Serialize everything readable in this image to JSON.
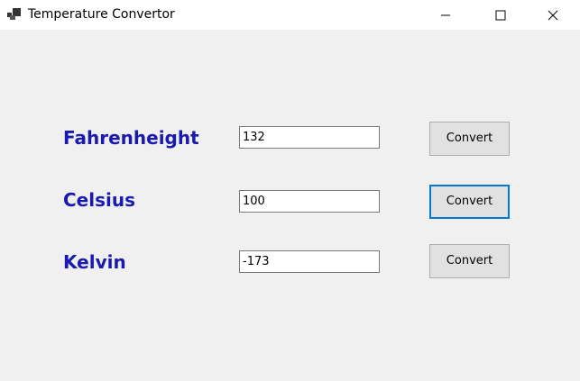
{
  "window": {
    "title": "Temperature Convertor"
  },
  "rows": [
    {
      "label": "Fahrenheight",
      "value": "132",
      "button": "Convert"
    },
    {
      "label": "Celsius",
      "value": "100",
      "button": "Convert"
    },
    {
      "label": "Kelvin",
      "value": "-173",
      "button": "Convert"
    }
  ],
  "colors": {
    "label": "#1a1ab0",
    "focus_border": "#0078d7",
    "button_bg": "#e1e1e1",
    "window_bg": "#f0f0f0"
  },
  "icons": {
    "app": "app-icon",
    "minimize": "minimize-icon",
    "maximize": "maximize-icon",
    "close": "close-icon"
  }
}
